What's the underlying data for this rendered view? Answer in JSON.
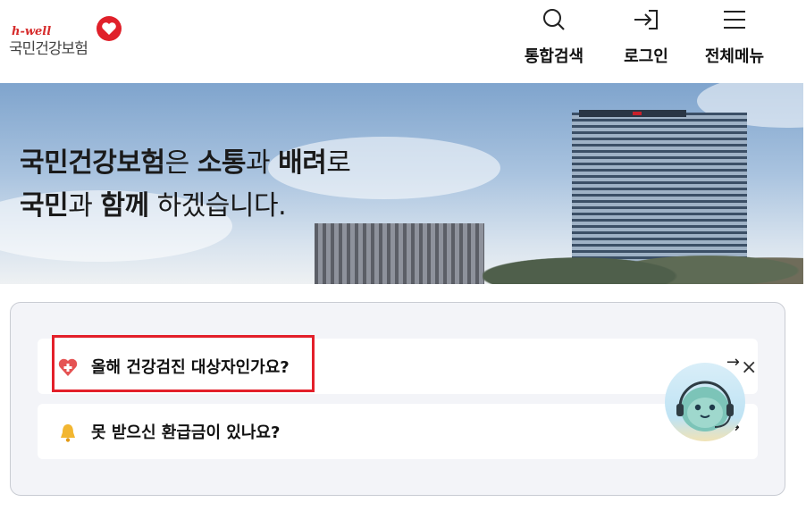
{
  "header": {
    "logo": {
      "brand": "h-well",
      "name": "국민건강보험"
    },
    "nav": [
      {
        "label": "통합검색",
        "icon": "search-icon"
      },
      {
        "label": "로그인",
        "icon": "login-icon"
      },
      {
        "label": "전체메뉴",
        "icon": "hamburger-menu-icon"
      }
    ]
  },
  "hero": {
    "line1": {
      "a": "국민건강보험",
      "b": "은 ",
      "c": "소통",
      "d": "과 ",
      "e": "배려",
      "f": "로"
    },
    "line2": {
      "a": "국민",
      "b": "과 ",
      "c": "함께",
      "d": " 하겠습니다."
    }
  },
  "quick_links": [
    {
      "label": "올해 건강검진 대상자인가요?",
      "icon": "heart-cross-icon",
      "arrow": "→"
    },
    {
      "label": "못 받으신 환급금이 있나요?",
      "icon": "bell-icon",
      "arrow": "→"
    }
  ],
  "chatbot": {
    "close": "×",
    "icon": "chatbot-character-icon"
  },
  "colors": {
    "brand_red": "#e3202a",
    "card_bg": "#f3f4f8",
    "border": "#c9ccd3"
  }
}
